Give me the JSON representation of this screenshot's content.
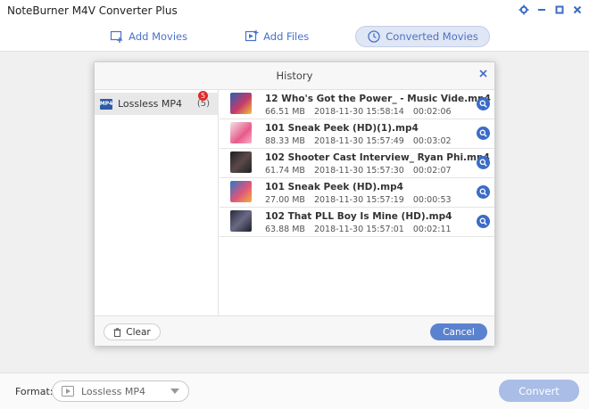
{
  "app": {
    "title": "NoteBurner M4V Converter Plus",
    "controls": [
      "gear-icon",
      "minimize-icon",
      "maximize-icon",
      "close-icon"
    ]
  },
  "nav": {
    "add_movies": "Add Movies",
    "add_files": "Add Files",
    "converted_movies": "Converted Movies"
  },
  "dialog": {
    "title": "History",
    "left": {
      "item_label": "Lossless MP4",
      "item_count": "(5)",
      "badge": "5"
    },
    "rows": [
      {
        "name": "12 Who's Got the Power_ - Music Vide.mp4",
        "size": "66.51 MB",
        "date": "2018-11-30",
        "time": "15:58:14",
        "duration": "00:02:06",
        "thumb_color": "#c73a6a"
      },
      {
        "name": "101 Sneak Peek (HD)(1).mp4",
        "size": "88.33 MB",
        "date": "2018-11-30",
        "time": "15:57:49",
        "duration": "00:03:02",
        "thumb_color": "#e85a8a"
      },
      {
        "name": "102 Shooter Cast Interview_ Ryan Phi.mp4",
        "size": "61.74 MB",
        "date": "2018-11-30",
        "time": "15:57:30",
        "duration": "00:02:07",
        "thumb_color": "#3a3a3a"
      },
      {
        "name": "101 Sneak Peek (HD).mp4",
        "size": "27.00 MB",
        "date": "2018-11-30",
        "time": "15:57:19",
        "duration": "00:00:53",
        "thumb_color": "#e0557a"
      },
      {
        "name": "102 That PLL Boy Is Mine (HD).mp4",
        "size": "63.88 MB",
        "date": "2018-11-30",
        "time": "15:57:01",
        "duration": "00:02:11",
        "thumb_color": "#4a4a5a"
      }
    ],
    "clear_label": "Clear",
    "cancel_label": "Cancel"
  },
  "footer": {
    "format_label": "Format:",
    "format_value": "Lossless MP4",
    "convert_label": "Convert"
  },
  "colors": {
    "accent": "#3b6cc7",
    "badge": "#e02a2a"
  }
}
